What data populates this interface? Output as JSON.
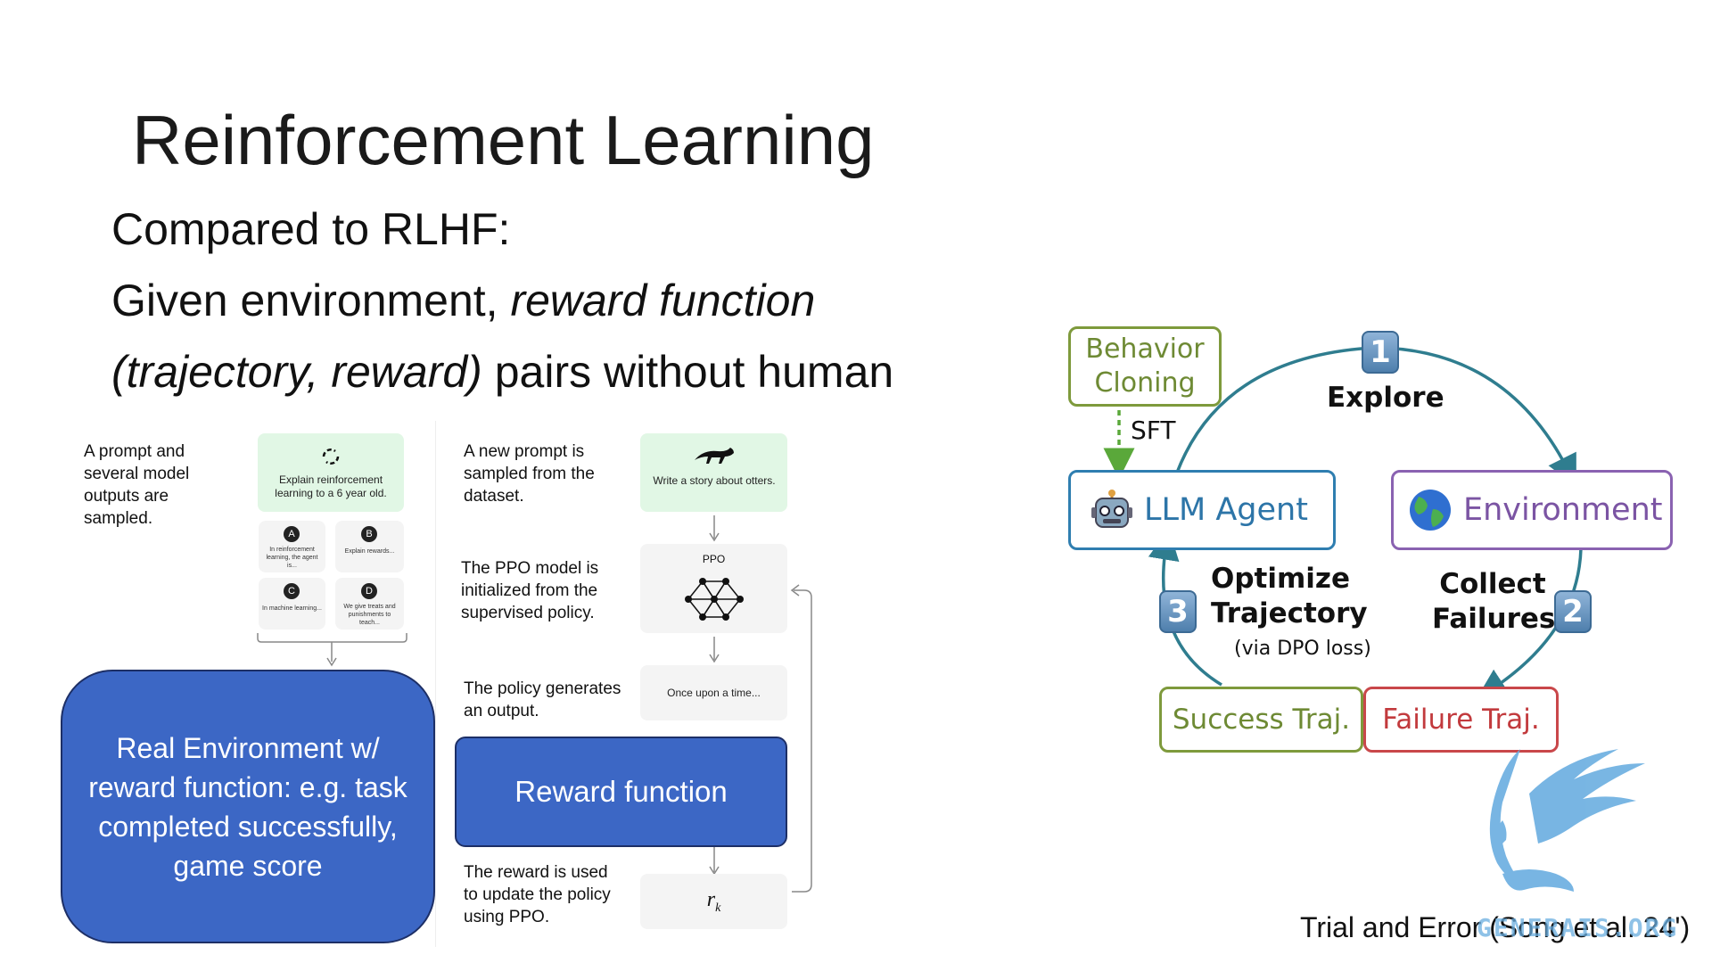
{
  "slide": {
    "title": "Reinforcement Learning",
    "line1": "Compared to RLHF:",
    "line2_plain": "Given environment, ",
    "line2_italic": "reward function",
    "line3_italic": "(trajectory, reward)",
    "line3_plain": " pairs without human",
    "caption": "Trial and Error (Song et al. 24')"
  },
  "rlhf_figure": {
    "step1_text": "A prompt and several model outputs are sampled.",
    "prompt_card": "Explain reinforcement learning to a 6 year old.",
    "outputs": [
      {
        "letter": "A",
        "text": "In reinforcement learning, the agent is..."
      },
      {
        "letter": "B",
        "text": "Explain rewards..."
      },
      {
        "letter": "C",
        "text": "In machine learning..."
      },
      {
        "letter": "D",
        "text": "We give treats and punishments to teach..."
      }
    ],
    "real_env_box": "Real Environment w/ reward function: e.g. task completed successfully, game score",
    "step2_text": "A new prompt is sampled from the dataset.",
    "story_card": "Write a story about otters.",
    "step3_text": "The PPO model is initialized from the supervised policy.",
    "ppo_label": "PPO",
    "step4_text": "The policy generates an output.",
    "output_card": "Once upon a time...",
    "reward_box": "Reward function",
    "step5_text": "The reward is used to update the policy using PPO.",
    "reward_symbol": "r",
    "reward_subscript": "k"
  },
  "cycle": {
    "behavior_cloning": "Behavior Cloning",
    "sft": "SFT",
    "llm_agent": "LLM Agent",
    "environment": "Environment",
    "explore": "Explore",
    "collect_failures": "Collect Failures",
    "optimize_trajectory": "Optimize Trajectory",
    "dpo_note": "(via DPO loss)",
    "success_traj": "Success Traj.",
    "failure_traj": "Failure Traj.",
    "badge1": "1",
    "badge2": "2",
    "badge3": "3"
  },
  "colors": {
    "blue_box": "#3c67c5",
    "green_node": "#7e9a3c",
    "blue_node": "#2f7eb0",
    "purple_node": "#8a62b1",
    "red_node": "#c9474a",
    "cycle_arrow": "#2f7d8f",
    "watermark": "#6aaee0"
  },
  "watermark": {
    "text": "GENERAIS.ORG"
  }
}
